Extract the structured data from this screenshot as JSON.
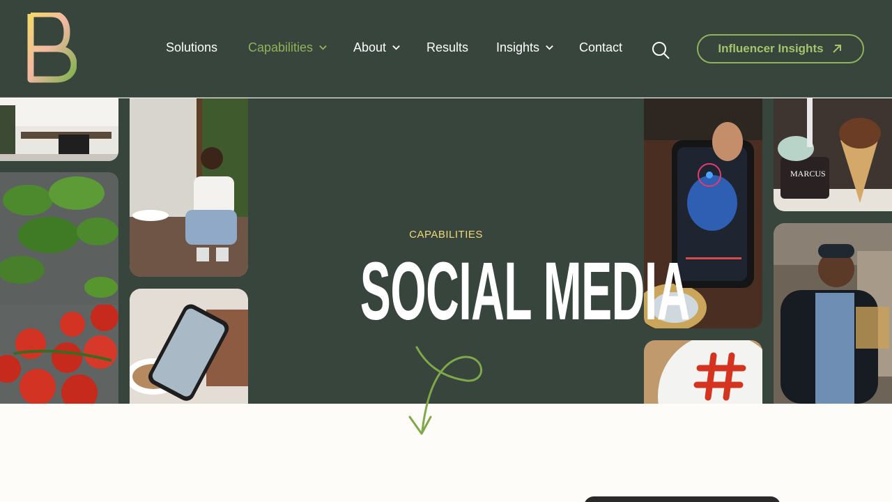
{
  "brand": {
    "logo_icon": "letter-b-logo",
    "colors": {
      "bg": "#37453c",
      "accent": "#8fb35a",
      "eyebrow": "#f2d878"
    }
  },
  "nav": {
    "items": [
      {
        "label": "Solutions",
        "dropdown": false
      },
      {
        "label": "Capabilities",
        "dropdown": true,
        "active": true
      },
      {
        "label": "About",
        "dropdown": true
      },
      {
        "label": "Results",
        "dropdown": false
      },
      {
        "label": "Insights",
        "dropdown": true
      },
      {
        "label": "Contact",
        "dropdown": false
      }
    ],
    "search_icon": "search-icon",
    "cta_label": "Influencer Insights",
    "cta_icon": "arrow-up-right-icon"
  },
  "hero": {
    "eyebrow": "CAPABILITIES",
    "title": "SOCIAL MEDIA",
    "scroll_icon": "curly-arrow-down-icon",
    "images": [
      "office-photo",
      "basil-photo",
      "tomatoes-photo",
      "woman-with-phone-photo",
      "phone-and-coffee-photo",
      "phone-food-photo",
      "ice-cream-photo",
      "hashtag-plate-photo",
      "chef-photo"
    ]
  }
}
